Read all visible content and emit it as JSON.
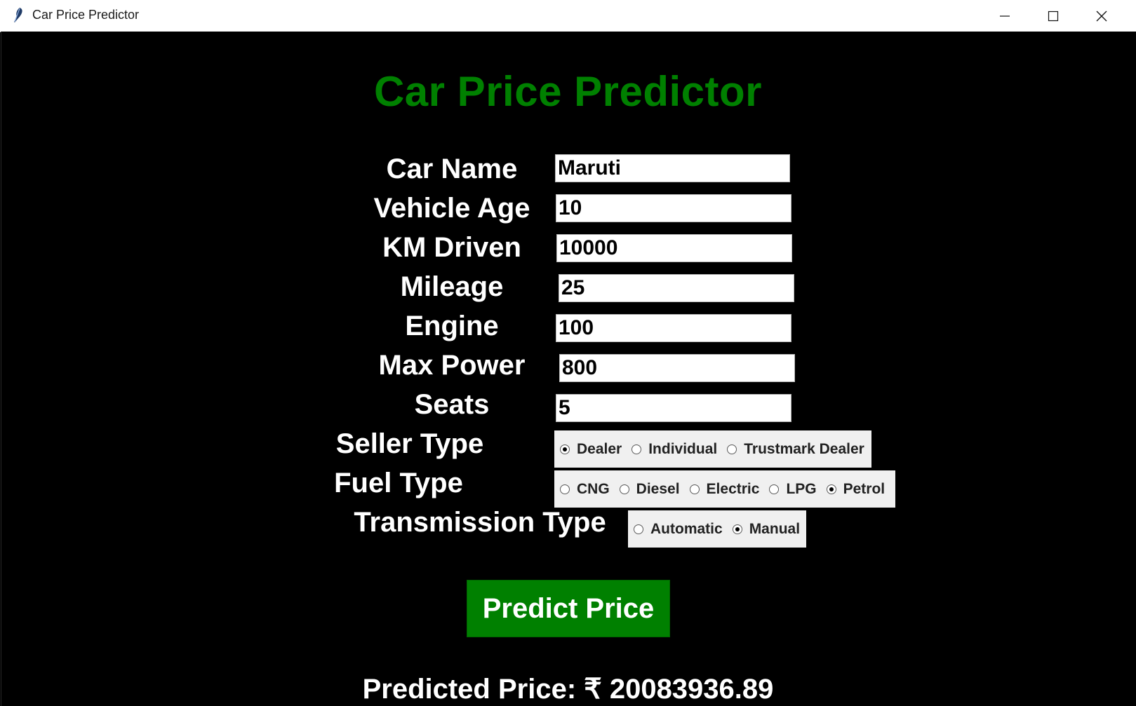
{
  "window": {
    "title": "Car Price Predictor"
  },
  "app": {
    "heading": "Car Price Predictor"
  },
  "fields": [
    {
      "label": "Car Name",
      "value": "Maruti"
    },
    {
      "label": "Vehicle Age",
      "value": "10"
    },
    {
      "label": "KM Driven",
      "value": "10000"
    },
    {
      "label": "Mileage",
      "value": "25"
    },
    {
      "label": "Engine",
      "value": "100"
    },
    {
      "label": "Max Power",
      "value": "800"
    },
    {
      "label": "Seats",
      "value": "5"
    }
  ],
  "seller_type": {
    "label": "Seller Type",
    "options": [
      "Dealer",
      "Individual",
      "Trustmark Dealer"
    ],
    "selected": "Dealer"
  },
  "fuel_type": {
    "label": "Fuel Type",
    "options": [
      "CNG",
      "Diesel",
      "Electric",
      "LPG",
      "Petrol"
    ],
    "selected": "Petrol"
  },
  "transmission_type": {
    "label": "Transmission Type",
    "options": [
      "Automatic",
      "Manual"
    ],
    "selected": "Manual"
  },
  "predict_button": {
    "label": "Predict Price"
  },
  "result": {
    "text": "Predicted Price: ₹ 20083936.89"
  },
  "icons": {
    "app": "feather-icon",
    "minimize": "minimize-icon",
    "maximize": "maximize-icon",
    "close": "close-icon"
  },
  "colors": {
    "accent": "#008000",
    "background": "#000000",
    "text": "#ffffff"
  }
}
